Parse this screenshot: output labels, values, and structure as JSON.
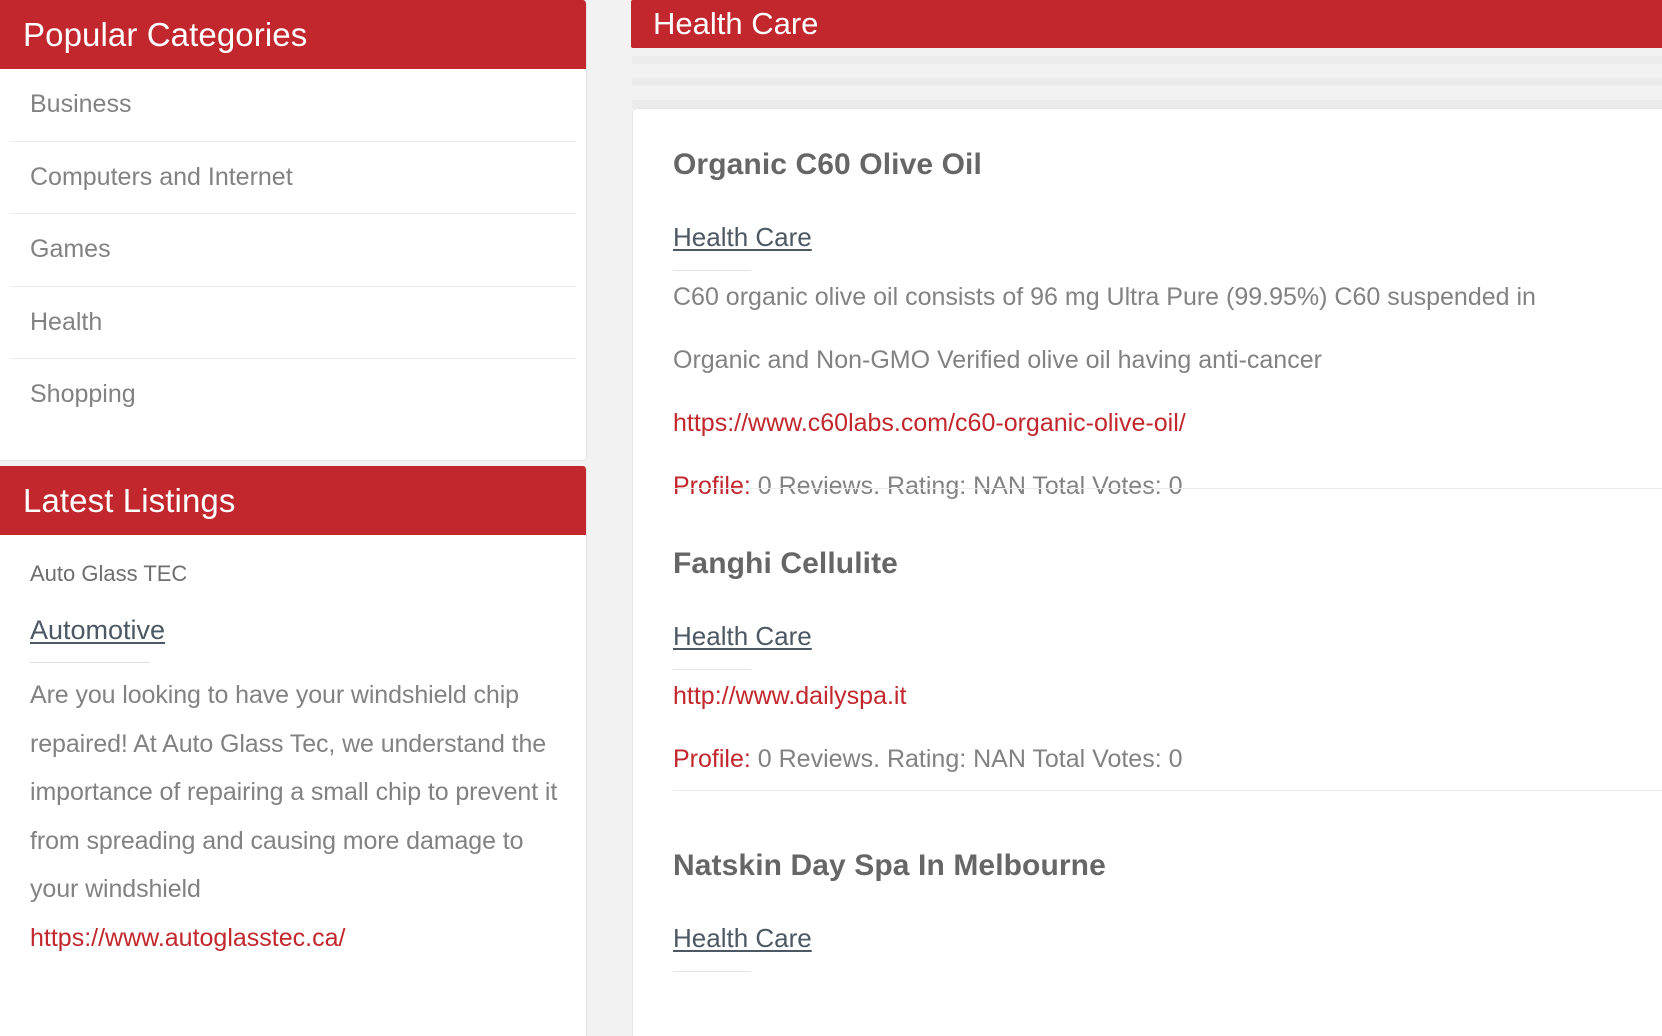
{
  "theme": {
    "accent_red": "#c1272d",
    "link_slate": "#4c5863",
    "body_gray": "#828282",
    "page_bg": "#f2f2f2"
  },
  "sidebar": {
    "categories_panel": {
      "header": "Popular Categories",
      "items": [
        {
          "label": "Business"
        },
        {
          "label": "Computers and Internet"
        },
        {
          "label": "Games"
        },
        {
          "label": "Health"
        },
        {
          "label": "Shopping"
        }
      ]
    },
    "listings_panel": {
      "header": "Latest Listings",
      "entries": [
        {
          "title": "Auto Glass TEC",
          "category": "Automotive",
          "description": "Are you looking to have your windshield chip repaired! At Auto Glass Tec, we understand the importance of repairing a small chip to prevent it from spreading and causing more damage to your windshield",
          "url": "https://www.autoglasstec.ca/"
        }
      ]
    }
  },
  "main": {
    "header": "Health Care",
    "listings": [
      {
        "title": "Organic C60 Olive Oil",
        "category": "Health Care",
        "description_lines": [
          "C60 organic olive oil consists of 96 mg Ultra Pure (99.95%) C60 suspended in",
          "Organic and Non-GMO Verified olive oil having anti-cancer"
        ],
        "url": "https://www.c60labs.com/c60-organic-olive-oil/",
        "profile_label": "Profile:",
        "profile_stats": " 0 Reviews. Rating: NAN Total Votes: 0"
      },
      {
        "title": "Fanghi Cellulite",
        "category": "Health Care",
        "description_lines": [],
        "url": "http://www.dailyspa.it",
        "profile_label": "Profile:",
        "profile_stats": " 0 Reviews. Rating: NAN Total Votes: 0"
      },
      {
        "title": "Natskin Day Spa In Melbourne",
        "category": "Health Care",
        "description_lines": [],
        "url": "",
        "profile_label": "",
        "profile_stats": ""
      }
    ]
  }
}
